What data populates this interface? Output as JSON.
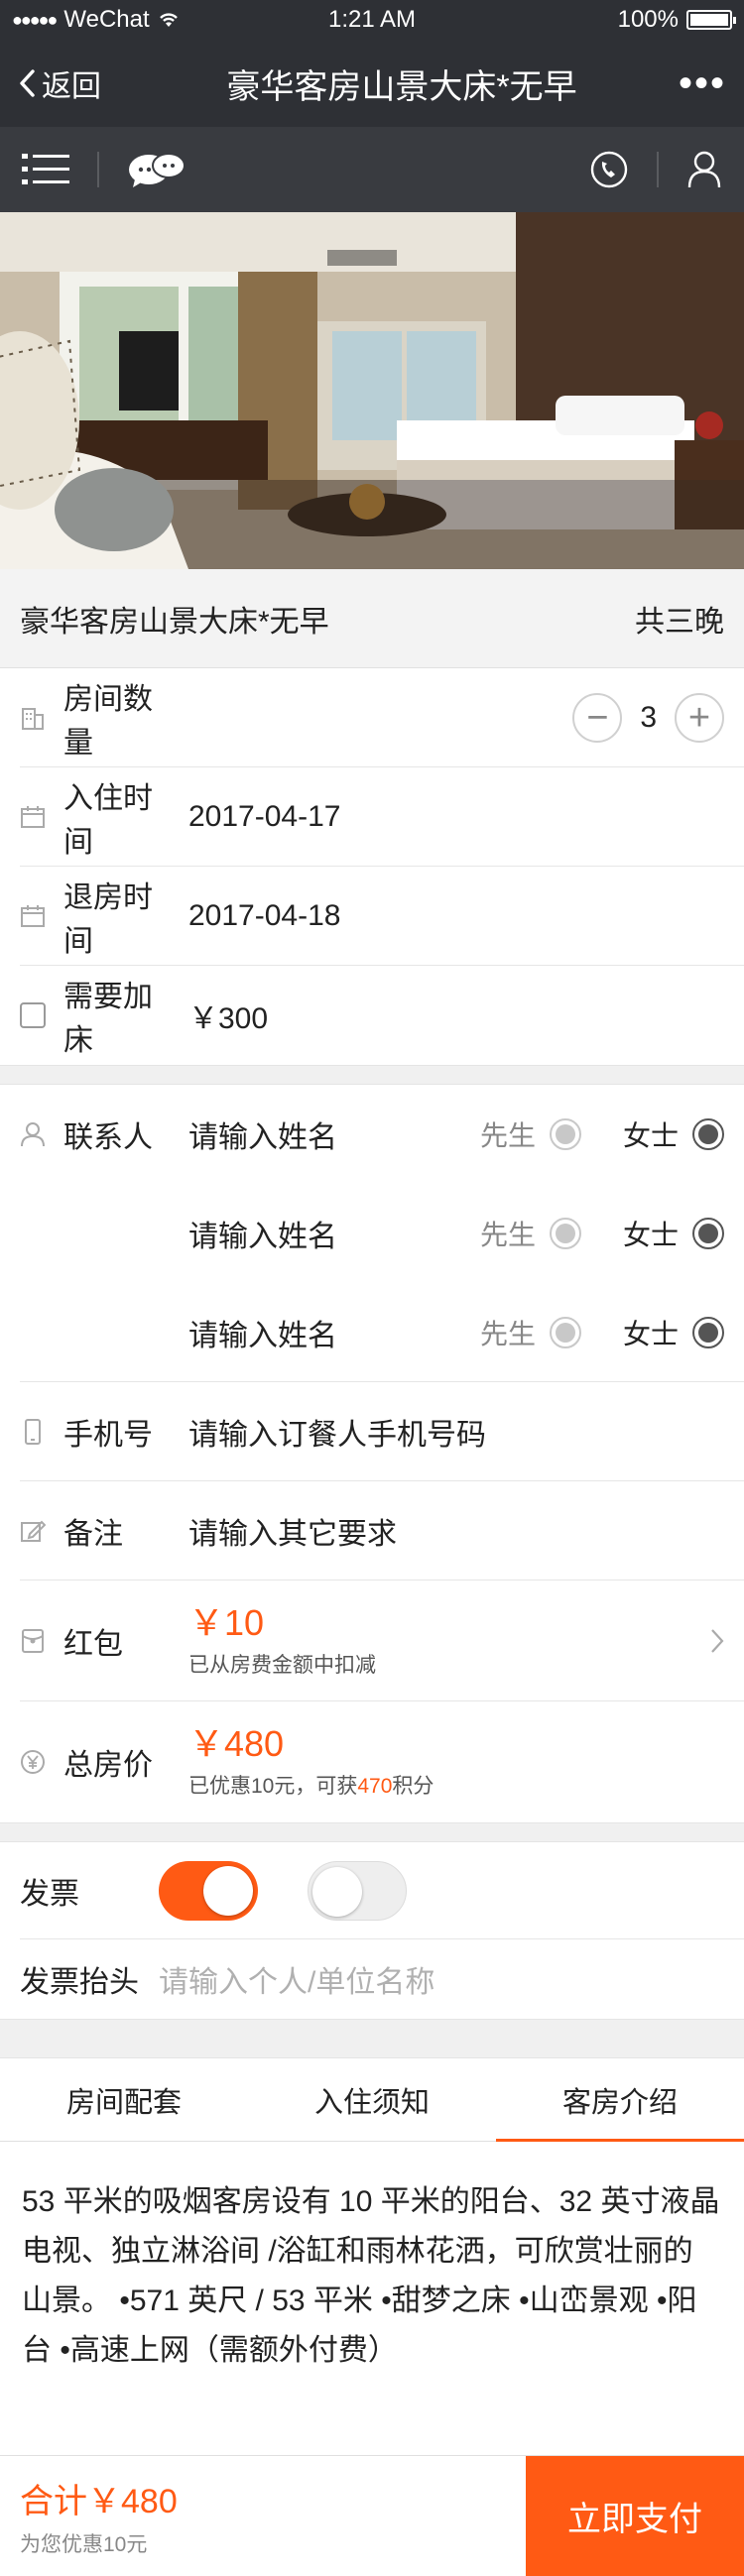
{
  "status_bar": {
    "signal": "●●●●●",
    "carrier": "WeChat",
    "time": "1:21 AM",
    "battery": "100%"
  },
  "nav": {
    "back_label": "返回",
    "title": "豪华客房山景大床*无早",
    "more": "•••"
  },
  "room": {
    "name": "豪华客房山景大床*无早",
    "nights": "共三晚"
  },
  "booking": {
    "rooms_label": "房间数量",
    "rooms_value": "3",
    "minus": "−",
    "plus": "+",
    "checkin_label": "入住时间",
    "checkin_value": "2017-04-17",
    "checkout_label": "退房时间",
    "checkout_value": "2017-04-18",
    "extra_bed_label": "需要加床",
    "extra_bed_price": "￥300"
  },
  "contact": {
    "label": "联系人",
    "placeholder": "请输入姓名",
    "mr": "先生",
    "ms": "女士"
  },
  "phone": {
    "label": "手机号",
    "placeholder": "请输入订餐人手机号码"
  },
  "remark": {
    "label": "备注",
    "placeholder": "请输入其它要求"
  },
  "red_packet": {
    "label": "红包",
    "amount": "￥10",
    "note": "已从房费金额中扣减"
  },
  "total": {
    "label": "总房价",
    "amount": "￥480",
    "note_prefix": "已优惠10元，可获",
    "points": "470",
    "note_suffix": "积分"
  },
  "invoice": {
    "label": "发票",
    "title_label": "发票抬头",
    "title_placeholder": "请输入个人/单位名称"
  },
  "tabs": [
    {
      "label": "房间配套"
    },
    {
      "label": "入住须知"
    },
    {
      "label": "客房介绍"
    }
  ],
  "description": "53 平米的吸烟客房设有 10 平米的阳台、32 英寸液晶电视、独立淋浴间 /浴缸和雨林花洒，可欣赏壮丽的山景。 •571 英尺 / 53 平米 •甜梦之床 •山峦景观 •阳台 •高速上网（需额外付费）",
  "footer": {
    "total": "合计￥480",
    "saving": "为您优惠10元",
    "pay_label": "立即支付"
  },
  "colors": {
    "accent": "#ff5a14",
    "nav_bg": "#2e3035",
    "toolbar_bg": "#393b40"
  }
}
